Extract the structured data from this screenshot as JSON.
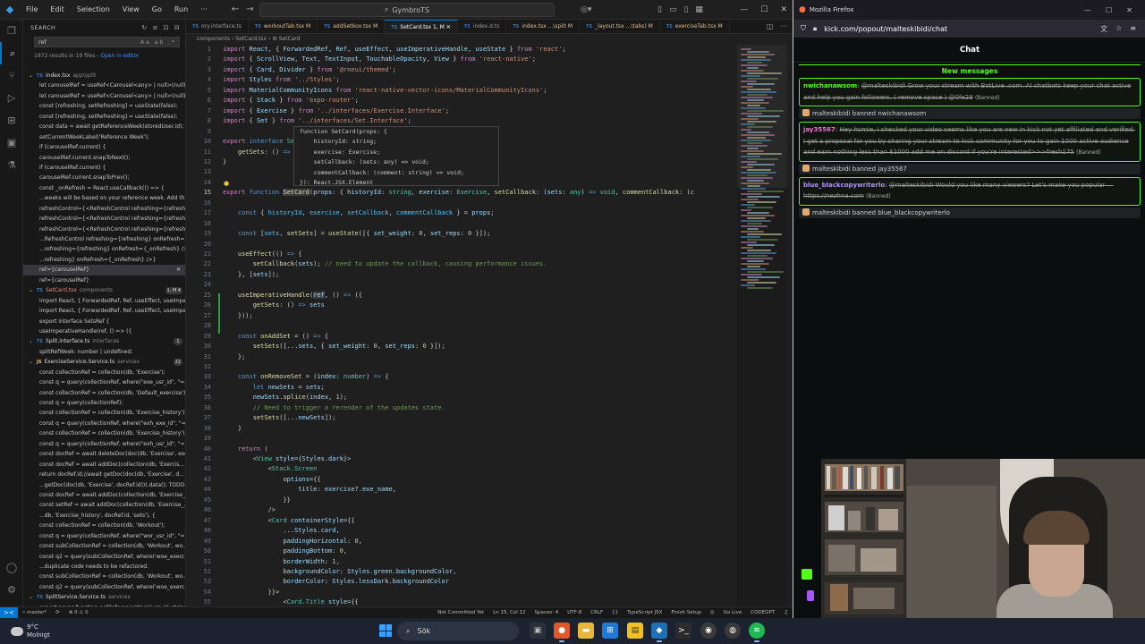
{
  "vscode": {
    "menu": [
      "File",
      "Edit",
      "Selection",
      "View",
      "Go",
      "Run"
    ],
    "command_center": "GymbroTS",
    "tabs": [
      {
        "label": "ory.interface.ts",
        "state": ""
      },
      {
        "label": "workoutTab.tsx M",
        "state": "mod"
      },
      {
        "label": "addSetbox.tsx M",
        "state": "mod"
      },
      {
        "label": "SetCard.tsx 1, M",
        "state": "active"
      },
      {
        "label": "index.d.ts",
        "state": ""
      },
      {
        "label": "index.tsx ...\\split M",
        "state": "mod"
      },
      {
        "label": "_layout.tsx ...\\tabs) M",
        "state": "mod"
      },
      {
        "label": "exerciseTab.tsx M",
        "state": "mod"
      }
    ],
    "breadcrumb": "components › SetCard.tsx › ⚙ SetCard",
    "search": {
      "header": "SEARCH",
      "query": "ref",
      "summary": "1972 results in 19 files - ",
      "summary_link": "Open in editor",
      "results": [
        {
          "t": "file",
          "icon": "TS",
          "name": "index.tsx",
          "dir": "app\\split",
          "badge": ""
        },
        {
          "t": "line",
          "text": "let carouselRef = useRef<Carousel<any> | null>(null);"
        },
        {
          "t": "line",
          "text": "let carouselRef = useRef<Carousel<any> | null>(null);"
        },
        {
          "t": "line",
          "text": "const [refreshing, setRefreshing] = useState(false);"
        },
        {
          "t": "line",
          "text": "const [refreshing, setRefreshing] = useState(false);"
        },
        {
          "t": "line",
          "text": "const data = await getReferenceWeek(storedUser.id);"
        },
        {
          "t": "line",
          "text": "setCurrentWeekLabel('Reference Week');"
        },
        {
          "t": "line",
          "text": "if (carouselRef.current) {"
        },
        {
          "t": "line",
          "text": "carouselRef.current.snapToNext();"
        },
        {
          "t": "line",
          "text": "if (carouselRef.current) {"
        },
        {
          "t": "line",
          "text": "carouselRef.current.snapToPrev();"
        },
        {
          "t": "line",
          "text": "const _onRefresh = React.useCallback(() => {"
        },
        {
          "t": "line",
          "text": "...weeks will be based on your reference week. Add th..."
        },
        {
          "t": "line",
          "text": "refreshControl={<RefreshControl refreshing={refreshi..."
        },
        {
          "t": "line",
          "text": "refreshControl={<RefreshControl refreshing={refreshi..."
        },
        {
          "t": "line",
          "text": "refreshControl={<RefreshControl refreshing={refreshi..."
        },
        {
          "t": "line",
          "text": "...RefreshControl refreshing={refreshing} onRefresh={..."
        },
        {
          "t": "line",
          "text": "...refreshing={refreshing} onRefresh={_onRefresh} />}"
        },
        {
          "t": "line",
          "text": "...refreshing} onRefresh={_onRefresh} />}"
        },
        {
          "t": "line",
          "text": "ref={carouselRef}",
          "sel": true
        },
        {
          "t": "line",
          "text": "ref={carouselRef}"
        },
        {
          "t": "file",
          "icon": "TS",
          "name": "SetCard.tsx",
          "dir": "components",
          "badge": "1, M  4",
          "err": true
        },
        {
          "t": "line",
          "text": "import React, { ForwardedRef, Ref, useEffect, useImpe..."
        },
        {
          "t": "line",
          "text": "import React, { ForwardedRef, Ref, useEffect, useImpe..."
        },
        {
          "t": "line",
          "text": "export interface SetsRef {"
        },
        {
          "t": "line",
          "text": "useImperativeHandle(ref, () => ({"
        },
        {
          "t": "file",
          "icon": "TS",
          "name": "Split.interface.ts",
          "dir": "interfaces",
          "badge": "1"
        },
        {
          "t": "line",
          "text": "splitRefWeek: number | undefined;"
        },
        {
          "t": "file",
          "icon": "JS",
          "name": "ExerciseService.Service.ts",
          "dir": "services",
          "badge": "22"
        },
        {
          "t": "line",
          "text": "const collectionRef = collection(db, 'Exercise');"
        },
        {
          "t": "line",
          "text": "const q = query(collectionRef, where(\"exe_usr_id\", \"=..."
        },
        {
          "t": "line",
          "text": "const collectionRef = collection(db, 'Default_exercise');"
        },
        {
          "t": "line",
          "text": "const q = query(collectionRef);"
        },
        {
          "t": "line",
          "text": "const collectionRef = collection(db, 'Exercise_history');"
        },
        {
          "t": "line",
          "text": "const q = query(collectionRef, where(\"exh_exe_id\", \"=..."
        },
        {
          "t": "line",
          "text": "const collectionRef = collection(db, 'Exercise_history');"
        },
        {
          "t": "line",
          "text": "const q = query(collectionRef, where(\"exh_usr_id\", \"=..."
        },
        {
          "t": "line",
          "text": "const docRef = await deleteDoc(doc(db, 'Exercise', exer..."
        },
        {
          "t": "line",
          "text": "const docRef = await addDoc(collection(db, 'Exercis..."
        },
        {
          "t": "line",
          "text": "return docRef.id;//await getDoc(doc(db, 'Exercise', d..."
        },
        {
          "t": "line",
          "text": "...getDoc(doc(db, 'Exercise', docRef.id))).data(); TODO..."
        },
        {
          "t": "line",
          "text": "const docRef = await addDoc(collection(db, 'Exercise_..."
        },
        {
          "t": "line",
          "text": "const setRef = await addDoc(collection(db, 'Exercise_..."
        },
        {
          "t": "line",
          "text": "...db, 'Exercise_history', docRef.id, 'sets'), {"
        },
        {
          "t": "line",
          "text": "const collectionRef = collection(db, 'Workout');"
        },
        {
          "t": "line",
          "text": "const q = query(collectionRef, where(\"wor_usr_id\", \"=..."
        },
        {
          "t": "line",
          "text": "const subCollectionRef = collection(db, 'Workout', wo..."
        },
        {
          "t": "line",
          "text": "const q2 = query(subCollectionRef, where('woe_exerc..."
        },
        {
          "t": "line",
          "text": "...duplicate code needs to be refactored."
        },
        {
          "t": "line",
          "text": "const subCollectionRef = collection(db, 'Workout', wo..."
        },
        {
          "t": "line",
          "text": "const q2 = query(subCollectionRef, where('woe_exerc..."
        },
        {
          "t": "file",
          "icon": "TS",
          "name": "SplitService.Service.ts",
          "dir": "services",
          "badge": ""
        },
        {
          "t": "line",
          "text": "export async function getReferenceWeek(usr_id: string..."
        }
      ]
    },
    "line_numbers": [
      "1",
      "2",
      "3",
      "4",
      "5",
      "6",
      "7",
      "8",
      "9",
      "10",
      "11",
      "12",
      "13",
      "14",
      "15",
      "16",
      "17",
      "18",
      "19",
      "20",
      "21",
      "22",
      "23",
      "24",
      "25",
      "26",
      "27",
      "28",
      "29",
      "30",
      "31",
      "32",
      "33",
      "34",
      "35",
      "36",
      "37",
      "38",
      "39",
      "40",
      "41",
      "42",
      "43",
      "44",
      "45",
      "46",
      "47",
      "48",
      "49",
      "50",
      "51",
      "52",
      "53",
      "54",
      "55"
    ],
    "current_line": "15",
    "hover": [
      "function SetCard(props: {",
      "    historyId: string;",
      "    exercise: Exercise;",
      "    setCallback: (sets: any) => void;",
      "    commentCallback: (comment: string) => void;",
      "}): React.JSX.Element"
    ],
    "status": {
      "branch": "master*",
      "sync": "⟳",
      "errors": "⊗ 0 ⚠ 0",
      "not_committed": "Not Committed Yet",
      "position": "Ln 15, Col 12",
      "spaces": "Spaces: 4",
      "encoding": "UTF-8",
      "eol": "CRLF",
      "braces": "{}",
      "language": "TypeScript JSX",
      "finish_setup": "Finish Setup",
      "go_live": "Go Live",
      "codegpt": "CODEGPT"
    }
  },
  "firefox": {
    "window_title": "Mozilla Firefox",
    "url": "kick.com/popout/malteskibidi/chat",
    "chat_title": "Chat",
    "new_messages": "New messages",
    "messages": [
      {
        "user": "nwichanawsom",
        "ucls": "u1",
        "text": "@malteskibidi Grow your stream with BotLive .com. AI chatbots keep your chat active and help you gain followers. ( remove space ) @0fe29",
        "note": "(Banned)"
      },
      {
        "ban": "malteskibidi banned nwichanawsom"
      },
      {
        "user": "jay35567",
        "ucls": "u2",
        "text": "Hey homie, i checked your video seems like you are new in kick not yet affiliated and verified. I get a proposal for you by sharing your stream to kick community for you to gain 1000 active audience and earn nothing less than $1000 add me on discord if you're interested>>>fresh175",
        "note": "(Banned)"
      },
      {
        "ban": "malteskibidi banned jay35567"
      },
      {
        "user": "blue_blackcopywriterlo",
        "ucls": "u3",
        "text": "@malteskibidi Would you like many viewers? Let's make you popular — https://nezhna.com",
        "note": "(Banned)"
      },
      {
        "ban": "malteskibidi banned blue_blackcopywriterlo"
      }
    ]
  },
  "taskbar": {
    "temperature": "9°C",
    "weather": "Molnigt",
    "search_placeholder": "Sök"
  }
}
